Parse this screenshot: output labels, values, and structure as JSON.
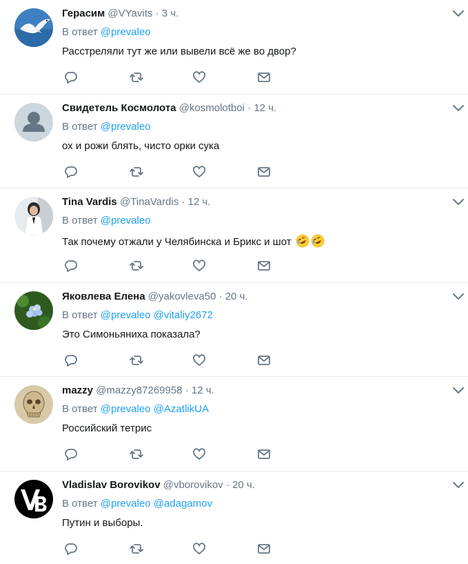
{
  "tweets": [
    {
      "name": "Герасим",
      "handle": "@VYavits",
      "dot": "·",
      "time": "3 ч.",
      "reply_prefix": "В ответ",
      "mentions": [
        "@prevaleo"
      ],
      "text": "Расстреляли тут же или вывели всё же во двор?",
      "avatar": "seagull"
    },
    {
      "name": "Свидетель Космолота",
      "handle": "@kosmolotboi",
      "dot": "·",
      "time": "12 ч.",
      "reply_prefix": "В ответ",
      "mentions": [
        "@prevaleo"
      ],
      "text": "ох и рожи блять, чисто орки сука",
      "avatar": "default-user"
    },
    {
      "name": "Tina Vardis",
      "handle": "@TinaVardis",
      "dot": "·",
      "time": "12 ч.",
      "reply_prefix": "В ответ",
      "mentions": [
        "@prevaleo"
      ],
      "text": "Так почему отжали у Челябинска и Брикс и шот",
      "emoji_count": 2,
      "avatar": "woman-photo"
    },
    {
      "name": "Яковлева Елена",
      "handle": "@yakovleva50",
      "dot": "·",
      "time": "20 ч.",
      "reply_prefix": "В ответ",
      "mentions": [
        "@prevaleo",
        "@vitaliy2672"
      ],
      "text": "Это Симоньяниха показала?",
      "avatar": "flowers"
    },
    {
      "name": "mazzy",
      "handle": "@mazzy87269958",
      "dot": "·",
      "time": "12 ч.",
      "reply_prefix": "В ответ",
      "mentions": [
        "@prevaleo",
        "@AzatlikUA"
      ],
      "text": "Российский тетрис",
      "avatar": "skull-drawing"
    },
    {
      "name": "Vladislav Borovikov",
      "handle": "@vborovikov",
      "dot": "·",
      "time": "20 ч.",
      "reply_prefix": "В ответ",
      "mentions": [
        "@prevaleo",
        "@adagamov"
      ],
      "text": "Путин и выборы.",
      "avatar": "vb-logo"
    }
  ],
  "icons": {
    "reply": "reply-icon",
    "retweet": "retweet-icon",
    "like": "heart-icon",
    "message": "envelope-icon",
    "more": "chevron-down-icon"
  },
  "colors": {
    "link": "#1da1f2",
    "muted": "#657786",
    "text": "#14171a",
    "divider": "#e6ecf0"
  }
}
